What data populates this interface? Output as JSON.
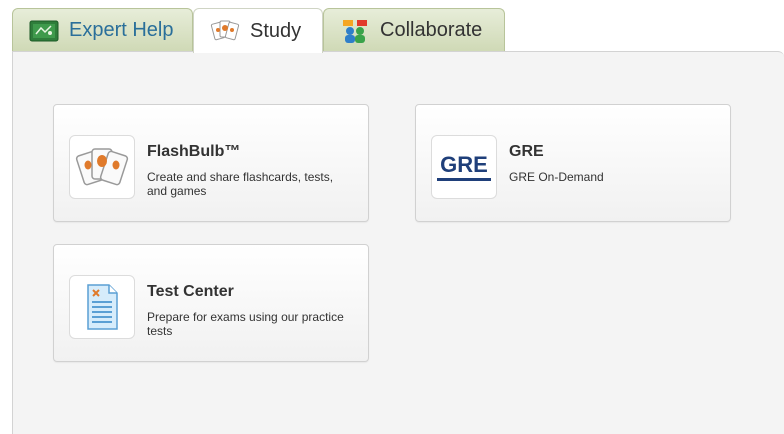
{
  "tabs": [
    {
      "label": "Expert Help",
      "icon": "chalkboard-icon",
      "active": false
    },
    {
      "label": "Study",
      "icon": "flashcards-icon",
      "active": true
    },
    {
      "label": "Collaborate",
      "icon": "people-icon",
      "active": false
    }
  ],
  "cards": [
    {
      "title": "FlashBulb™",
      "description": "Create and share flashcards, tests, and games",
      "icon": "flashcards-icon"
    },
    {
      "title": "GRE",
      "description": "GRE On-Demand",
      "icon": "gre-logo-icon",
      "logo_text": "GRE"
    },
    {
      "title": "Test Center",
      "description": "Prepare for exams using our practice tests",
      "icon": "test-document-icon"
    }
  ],
  "colors": {
    "tab_link": "#2a6f9a",
    "gre_blue": "#1f3f7a",
    "tab_green": "#cfd9b5"
  }
}
